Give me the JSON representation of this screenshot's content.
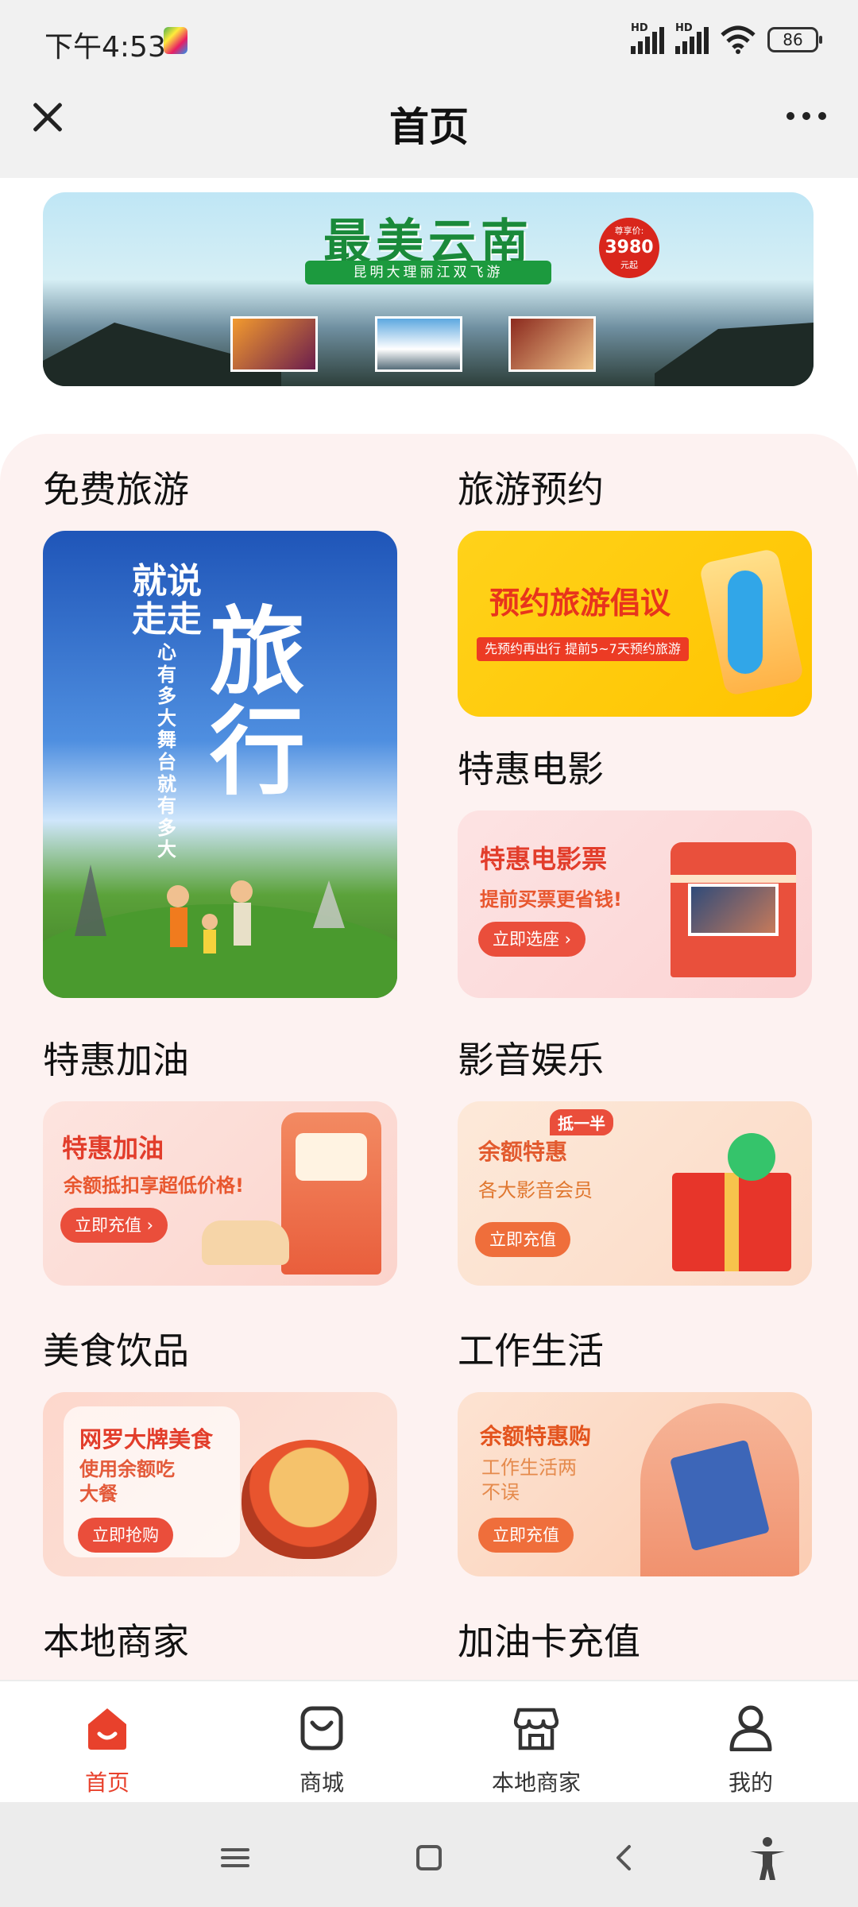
{
  "status": {
    "time": "下午4:53",
    "battery": "86",
    "network": "HD"
  },
  "nav": {
    "title": "首页"
  },
  "banner": {
    "title": "最美云南",
    "subtitle": "昆明大理丽江双飞游",
    "price_label": "尊享价:",
    "price": "3980",
    "price_unit": "元起"
  },
  "sections": {
    "free_travel": {
      "title": "免费旅游",
      "tag1": "就说",
      "tag2": "走走",
      "poem": "心有多大 舞台就有多大",
      "big": "旅行"
    },
    "travel_booking": {
      "title": "旅游预约",
      "head": "预约旅游倡议",
      "sub": "先预约再出行 提前5~7天预约旅游"
    },
    "movie": {
      "title": "特惠电影",
      "head": "特惠电影票",
      "sub": "提前买票更省钱!",
      "button": "立即选座 ›"
    },
    "fuel": {
      "title": "特惠加油",
      "head": "特惠加油",
      "sub": "余额抵扣享超低价格!",
      "button": "立即充值 ›"
    },
    "av": {
      "title": "影音娱乐",
      "badge": "抵一半",
      "head": "余额特惠",
      "sub": "各大影音会员",
      "button": "立即充值"
    },
    "food": {
      "title": "美食饮品",
      "head": "网罗大牌美食",
      "sub1": "使用余额吃",
      "sub2": "大餐",
      "button": "立即抢购"
    },
    "work": {
      "title": "工作生活",
      "head": "余额特惠购",
      "sub1": "工作生活两",
      "sub2": "不误",
      "button": "立即充值"
    },
    "local": {
      "title": "本地商家"
    },
    "fuelcard": {
      "title": "加油卡充值"
    }
  },
  "tabbar": {
    "items": [
      {
        "label": "首页",
        "icon": "home-icon",
        "active": true
      },
      {
        "label": "商城",
        "icon": "shopping-bag-icon",
        "active": false
      },
      {
        "label": "本地商家",
        "icon": "store-icon",
        "active": false
      },
      {
        "label": "我的",
        "icon": "user-icon",
        "active": false
      }
    ]
  },
  "colors": {
    "accent": "#e8412c",
    "panel_bg": "#fdf2f1",
    "banner_green": "#1a8a3a"
  }
}
